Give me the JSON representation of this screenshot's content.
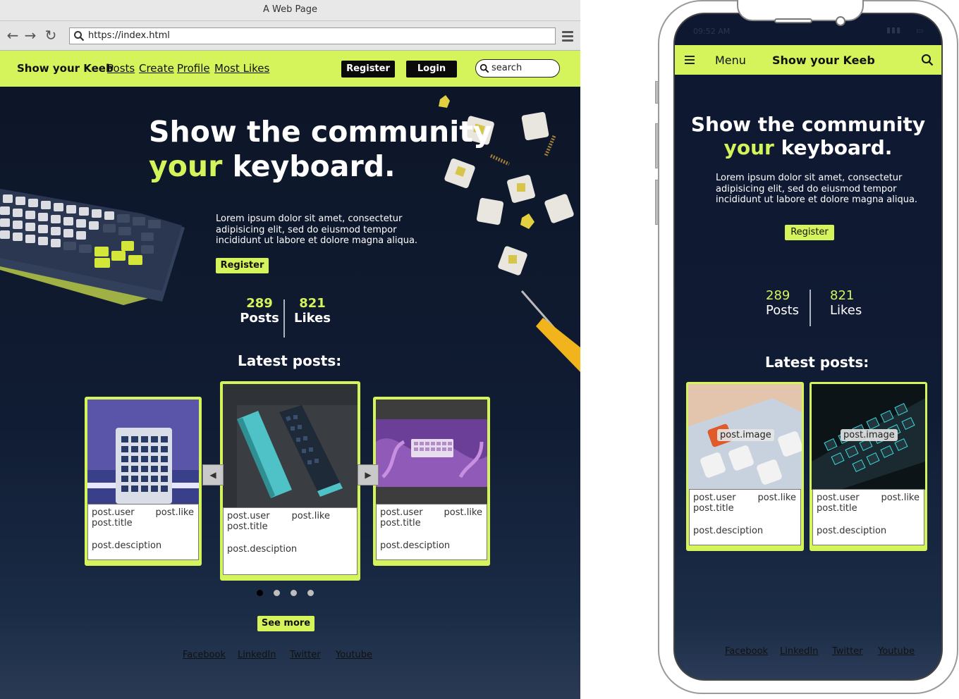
{
  "browser": {
    "window_title": "A Web Page",
    "url": "https://index.html"
  },
  "site": {
    "brand": "Show your Keeb",
    "nav_links": [
      "Posts",
      "Create",
      "Profile",
      "Most Likes"
    ],
    "register_label": "Register",
    "login_label": "Login",
    "search_placeholder": "search",
    "accent_color": "#d5f35a"
  },
  "hero": {
    "title_line1": "Show the community",
    "title_accent": "your",
    "title_rest": "keyboard.",
    "text": "Lorem ipsum dolor sit amet, consectetur adipisicing elit, sed do eiusmod tempor incididunt ut labore et dolore magna aliqua.",
    "register_label": "Register"
  },
  "stats": {
    "posts_count": "289",
    "posts_label": "Posts",
    "likes_count": "821",
    "likes_label": "Likes"
  },
  "latest": {
    "heading": "Latest posts:",
    "card": {
      "user": "post.user",
      "like": "post.like",
      "title": "post.title",
      "description": "post.desciption",
      "image_tag": "post.image"
    },
    "carousel_pages": 4,
    "active_page": 1,
    "see_more_label": "See more"
  },
  "footer": {
    "links": [
      "Facebook",
      "LinkedIn",
      "Twitter",
      "Youtube"
    ]
  },
  "mobile": {
    "status_time": "09:52 AM",
    "menu_label": "Menu",
    "brand": "Show your Keeb"
  }
}
